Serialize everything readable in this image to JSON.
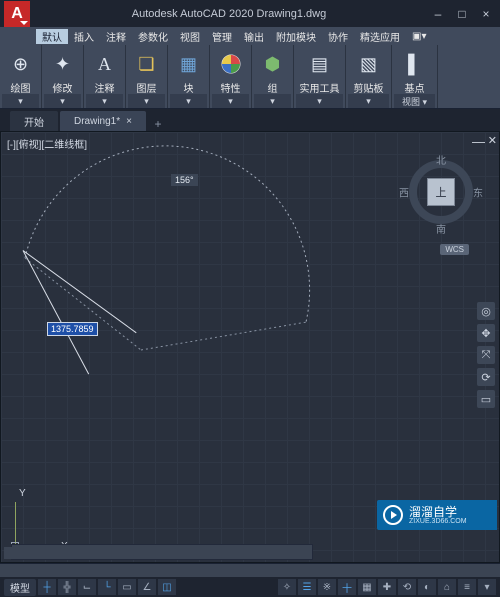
{
  "title": "Autodesk AutoCAD 2020   Drawing1.dwg",
  "logo_letter": "A",
  "window": {
    "min": "–",
    "max": "□",
    "close": "×"
  },
  "menus": [
    "默认",
    "插入",
    "注释",
    "参数化",
    "视图",
    "管理",
    "输出",
    "附加模块",
    "协作",
    "精选应用"
  ],
  "ribbon": [
    {
      "icon": "⊕",
      "label": "绘图",
      "drop": "▾"
    },
    {
      "icon": "✦",
      "label": "修改",
      "drop": "▾"
    },
    {
      "icon": "A",
      "label": "注释",
      "drop": "▾"
    },
    {
      "icon": "❏",
      "label": "图层",
      "drop": "▾"
    },
    {
      "icon": "▦",
      "label": "块",
      "drop": "▾"
    },
    {
      "icon": "◕",
      "label": "特性",
      "drop": "▾"
    },
    {
      "icon": "⬢",
      "label": "组",
      "drop": "▾"
    },
    {
      "icon": "▤",
      "label": "实用工具",
      "drop": "▾"
    },
    {
      "icon": "▧",
      "label": "剪贴板",
      "drop": "▾"
    },
    {
      "icon": "▌",
      "label": "基点",
      "foot": "视图 ▾"
    }
  ],
  "tabs": {
    "start": "开始",
    "doc": "Drawing1*",
    "close": "×",
    "plus": "+"
  },
  "viewport": {
    "controls": "[-][俯视][二维线框]",
    "minimize": "—",
    "close": "✕",
    "cube_top": "上",
    "dir_n": "北",
    "dir_s": "南",
    "dir_e": "东",
    "dir_w": "西",
    "wcs": "WCS",
    "angle": "156°",
    "input_value": "1375.7859",
    "ucs_x": "X",
    "ucs_y": "Y"
  },
  "watermark": {
    "cn": "溜溜自学",
    "url": "ZIXUE.3D66.COM"
  },
  "status": {
    "model": "模型",
    "icons": [
      "┼",
      "╬",
      "⌙",
      "└",
      "▭",
      "∠",
      "◫",
      "✧",
      "☰",
      "※",
      "十",
      "▦",
      "✚",
      "⟲",
      "◐",
      "⌂",
      "≡",
      "▾"
    ]
  }
}
